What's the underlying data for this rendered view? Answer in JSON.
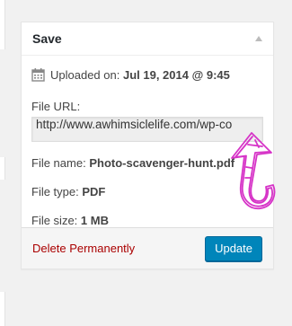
{
  "panel": {
    "title": "Save",
    "toggle_icon": "collapse-arrow-up"
  },
  "uploaded": {
    "label": "Uploaded on:",
    "date": "Jul 19, 2014 @ 9:45",
    "icon": "calendar-icon"
  },
  "file_url": {
    "label": "File URL:",
    "value": "http://www.awhimsiclelife.com/wp-co"
  },
  "file_name": {
    "label": "File name:",
    "value": "Photo-scavenger-hunt.pdf"
  },
  "file_type": {
    "label": "File type:",
    "value": "PDF"
  },
  "file_size": {
    "label": "File size:",
    "value": "1 MB"
  },
  "actions": {
    "delete_label": "Delete Permanently",
    "update_label": "Update"
  },
  "annotation": {
    "icon": "hand-drawn-arrow-icon",
    "color": "#d633c7"
  },
  "colors": {
    "update_button": "#0085ba",
    "delete_link": "#aa0000"
  }
}
